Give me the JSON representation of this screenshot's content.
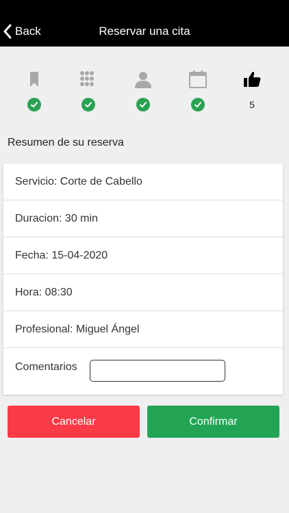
{
  "nav": {
    "back_label": "Back",
    "title": "Reservar una cita"
  },
  "steps": [
    {
      "icon": "bookmark-icon",
      "status": "done"
    },
    {
      "icon": "grid-icon",
      "status": "done"
    },
    {
      "icon": "user-icon",
      "status": "done"
    },
    {
      "icon": "calendar-icon",
      "status": "done"
    },
    {
      "icon": "thumbs-up-icon",
      "status": "current",
      "number": "5"
    }
  ],
  "summary": {
    "title": "Resumen de su reserva",
    "servicio": "Servicio: Corte de Cabello",
    "duracion": "Duracion: 30 min",
    "fecha": "Fecha: 15-04-2020",
    "hora": "Hora: 08:30",
    "profesional": "Profesional: Miguel Ángel",
    "comentarios_label": "Comentarios",
    "comentarios_value": "",
    "comentarios_placeholder": ""
  },
  "buttons": {
    "cancel": "Cancelar",
    "confirm": "Confirmar"
  },
  "colors": {
    "nav_bg": "#000000",
    "check": "#2ba153",
    "cancel": "#fa3a47",
    "confirm": "#23a455",
    "inactive_icon": "#a8a8a8",
    "active_icon": "#000000"
  }
}
